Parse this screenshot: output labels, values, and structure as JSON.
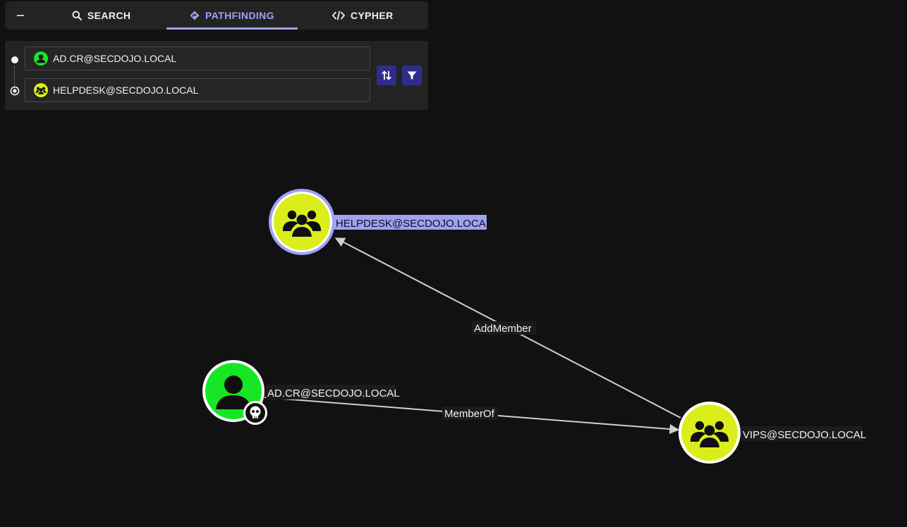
{
  "tabs": {
    "collapse_icon": "minus-icon",
    "items": [
      {
        "label": "SEARCH",
        "icon": "search-icon",
        "active": false
      },
      {
        "label": "PATHFINDING",
        "icon": "pathfinding-icon",
        "active": true
      },
      {
        "label": "CYPHER",
        "icon": "code-icon",
        "active": false
      }
    ]
  },
  "pathfinding": {
    "start": {
      "value": "AD.CR@SECDOJO.LOCAL",
      "icon": "user-icon",
      "icon_color": "#17e625"
    },
    "destination": {
      "value": "HELPDESK@SECDOJO.LOCAL",
      "icon": "group-icon",
      "icon_color": "#dbee1b"
    },
    "swap_icon": "swap-icon",
    "filter_icon": "filter-icon"
  },
  "graph": {
    "nodes": [
      {
        "label": "HELPDESK@SECDOJO.LOCAL",
        "type": "group",
        "color": "#dbee1b",
        "selected": true
      },
      {
        "label": "AD.CR@SECDOJO.LOCAL",
        "type": "user",
        "color": "#17e625",
        "owned": true
      },
      {
        "label": "VIPS@SECDOJO.LOCAL",
        "type": "group",
        "color": "#dbee1b"
      }
    ],
    "edges": [
      {
        "label": "AddMember",
        "from": "VIPS@SECDOJO.LOCAL",
        "to": "HELPDESK@SECDOJO.LOCAL"
      },
      {
        "label": "MemberOf",
        "from": "AD.CR@SECDOJO.LOCAL",
        "to": "VIPS@SECDOJO.LOCAL"
      }
    ],
    "colors": {
      "selection_ring": "#9ea2f3",
      "selection_label_bg": "#9ea2f3",
      "edge": "#cfcfcf"
    }
  }
}
